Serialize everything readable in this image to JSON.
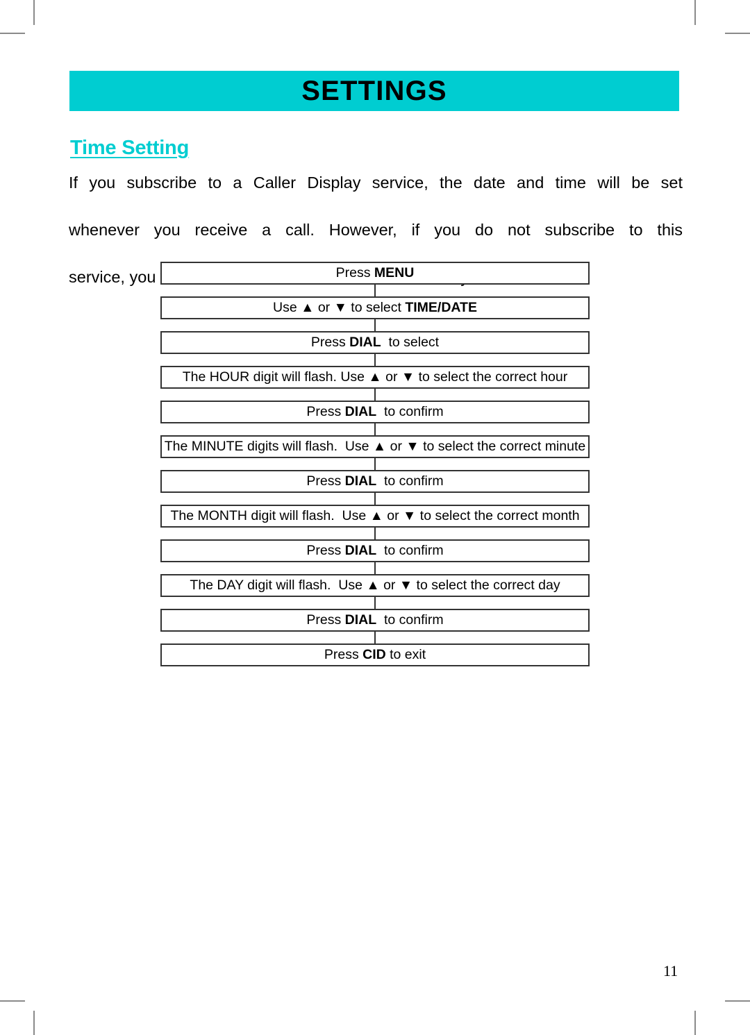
{
  "header": {
    "title": "SETTINGS",
    "band_color": "#00cdd1"
  },
  "section": {
    "heading": "Time Setting",
    "heading_color": "#00cdd1"
  },
  "intro": {
    "line1": "If you subscribe to a Caller Display service, the date and time will be set",
    "line2": "whenever you receive a call.  However, if you do not subscribe to this",
    "line3": "service, you will need to set the date and time manually.",
    "full_text": "If you subscribe to a Caller Display service, the date and time will be set whenever you receive a call.  However, if you do not subscribe to this service, you will need to set the date and time manually."
  },
  "flowchart": {
    "steps": [
      {
        "id": "press-menu",
        "pre": "Press ",
        "bold": "MENU",
        "post": ""
      },
      {
        "id": "select-time-date",
        "pre": "Use ▲ or ▼ to select ",
        "bold": "TIME/DATE",
        "post": ""
      },
      {
        "id": "press-dial-select",
        "pre": "Press ",
        "bold": "DIAL",
        "post": "  to select"
      },
      {
        "id": "hour-flash",
        "pre": "The HOUR digit will flash. Use ▲ or ▼ to select the correct hour",
        "bold": "",
        "post": ""
      },
      {
        "id": "press-dial-confirm-hour",
        "pre": "Press ",
        "bold": "DIAL",
        "post": "  to confirm"
      },
      {
        "id": "minute-flash",
        "pre": "The MINUTE digits will flash.  Use ▲ or ▼ to select the correct minute",
        "bold": "",
        "post": ""
      },
      {
        "id": "press-dial-confirm-minute",
        "pre": "Press ",
        "bold": "DIAL",
        "post": "  to confirm"
      },
      {
        "id": "month-flash",
        "pre": "The MONTH digit will flash.  Use ▲ or ▼ to select the correct month",
        "bold": "",
        "post": ""
      },
      {
        "id": "press-dial-confirm-month",
        "pre": "Press ",
        "bold": "DIAL",
        "post": "  to confirm"
      },
      {
        "id": "day-flash",
        "pre": "The DAY digit will flash.  Use ▲ or ▼ to select the correct day",
        "bold": "",
        "post": ""
      },
      {
        "id": "press-dial-confirm-day",
        "pre": "Press ",
        "bold": "DIAL",
        "post": "  to confirm"
      },
      {
        "id": "press-cid-exit",
        "pre": "Press ",
        "bold": "CID",
        "post": " to exit"
      }
    ]
  },
  "footer": {
    "page_number": "11"
  }
}
